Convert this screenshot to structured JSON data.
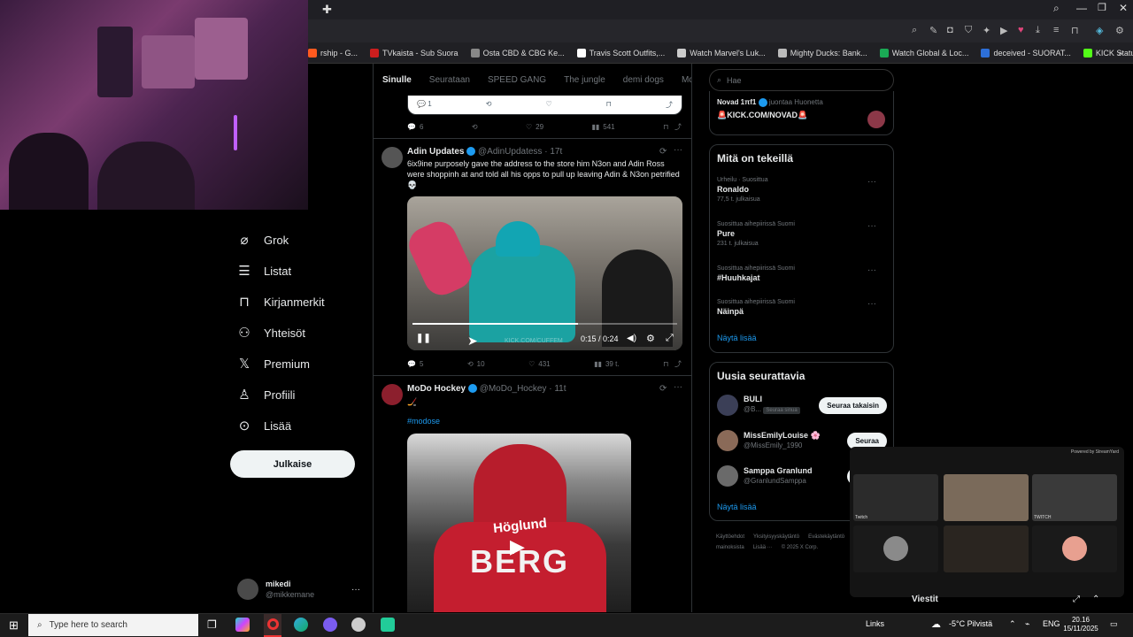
{
  "colors": {
    "accent": "#1d9bf0",
    "background": "#000000",
    "muted": "#71767b",
    "text": "#e7e9ea"
  },
  "bookmarks": [
    {
      "label": "rship - G...",
      "color": "#ff5a1f"
    },
    {
      "label": "TVkaista - Sub Suora",
      "color": "#cc1e1e"
    },
    {
      "label": "Osta CBD & CBG Ke...",
      "color": "#888888"
    },
    {
      "label": "Travis Scott Outfits,...",
      "color": "#ffffff"
    },
    {
      "label": "Watch Marvel's Luk...",
      "color": "#cccccc"
    },
    {
      "label": "Mighty Ducks: Bank...",
      "color": "#bbbbbb"
    },
    {
      "label": "Watch Global & Loc...",
      "color": "#1aaa55"
    },
    {
      "label": "deceived - SUORAT...",
      "color": "#2d6fd8"
    },
    {
      "label": "KICK Status Page",
      "color": "#53fc18"
    }
  ],
  "nav": {
    "items": [
      {
        "label": "Grok",
        "icon": "grok-icon"
      },
      {
        "label": "Listat",
        "icon": "list-icon"
      },
      {
        "label": "Kirjanmerkit",
        "icon": "bookmark-icon"
      },
      {
        "label": "Yhteisöt",
        "icon": "community-icon"
      },
      {
        "label": "Premium",
        "icon": "x-logo-icon"
      },
      {
        "label": "Profiili",
        "icon": "profile-icon"
      },
      {
        "label": "Lisää",
        "icon": "more-circle-icon"
      }
    ],
    "post_button": "Julkaise",
    "account": {
      "name": "mikedi",
      "handle": "@mikkemane"
    }
  },
  "timeline": {
    "tabs": [
      "Sinulle",
      "Seurataan",
      "SPEED GANG",
      "The jungle",
      "demi dogs",
      "McDonald"
    ],
    "prev_tweet_actions": {
      "replies": "1",
      "likes": "",
      "views": ""
    },
    "prev_tweet_stats": {
      "replies": "6",
      "retweets": "",
      "likes": "29",
      "views": "541"
    },
    "tweets": [
      {
        "name": "Adin Updates",
        "handle": "@AdinUpdatess",
        "time": "17t",
        "text": "6ix9ine purposely gave the address to the store him N3on and Adin Ross were shoppinh at and told all his opps to pull up leaving Adin & N3on petrified💀",
        "video": {
          "time": "0:15 / 0:24",
          "progress": 0.625,
          "watermark": "KICK.COM/CUFFEM"
        },
        "stats": {
          "replies": "5",
          "retweets": "10",
          "likes": "431",
          "views": "39 t."
        }
      },
      {
        "name": "MoDo Hockey",
        "handle": "@MoDo_Hockey",
        "time": "11t",
        "text": "🏒",
        "hashtag": "#modose",
        "image_text": "BERG",
        "image_text2": "Höglund"
      }
    ]
  },
  "search": {
    "placeholder": "Hae"
  },
  "live_card": {
    "name": "Novad 1πf1",
    "label": "juontaa Huonetta",
    "text": "🚨KICK.COM/NOVAD🚨"
  },
  "trends": {
    "title": "Mitä on tekeillä",
    "items": [
      {
        "context": "Urheilu · Suosittua",
        "name": "Ronaldo",
        "count": "77,5 t. julkaisua"
      },
      {
        "context": "Suosittua aihepiirissä Suomi",
        "name": "Pure",
        "count": "231 t. julkaisua"
      },
      {
        "context": "Suosittua aihepiirissä Suomi",
        "name": "#Huuhkajat",
        "count": ""
      },
      {
        "context": "Suosittua aihepiirissä Suomi",
        "name": "Näinpä",
        "count": ""
      }
    ],
    "show_more": "Näytä lisää"
  },
  "who_to_follow": {
    "title": "Uusia seurattavia",
    "items": [
      {
        "name": "BULI",
        "handle": "@B...",
        "badge": "Seuraa sinua",
        "button": "Seuraa takaisin"
      },
      {
        "name": "MissEmilyLouise 🌸",
        "handle": "@MissEmily_1990",
        "badge": "",
        "button": "Seuraa"
      },
      {
        "name": "Samppa Granlund",
        "handle": "@GranlundSamppa",
        "badge": "",
        "button": "Seuraa"
      }
    ],
    "show_more": "Näytä lisää"
  },
  "footer_links": [
    "Käyttöehdot",
    "Yksityisyyskäytäntö",
    "Evästekäytäntö",
    "Esteettömyys",
    "Tietoa mainoksista",
    "Lisää ···",
    "© 2025 X Corp."
  ],
  "call_overlay": {
    "badge": "Powered by StreamYard",
    "participants": [
      "Twitch",
      "",
      "TWITCH",
      "",
      "",
      ""
    ]
  },
  "overlay_partial": {
    "label": "Viestit"
  },
  "taskbar": {
    "search_placeholder": "Type here to search",
    "links": "Links",
    "weather": "-5°C Pilvistä",
    "lang": "ENG",
    "time": "20.16",
    "date": "15/11/2025"
  }
}
